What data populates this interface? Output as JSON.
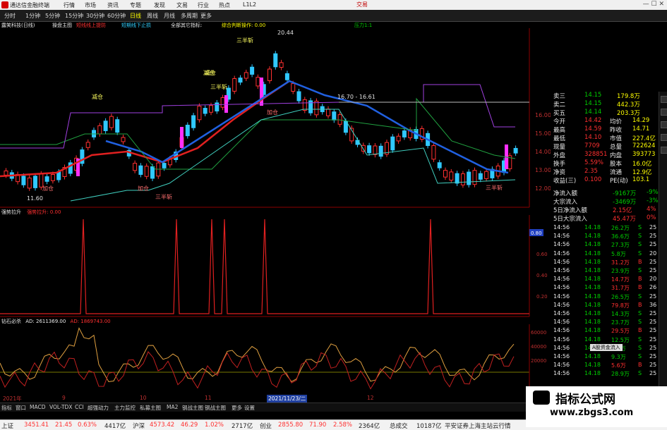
{
  "titlebar": {
    "title": "通达信金融终端",
    "right_text": "交易"
  },
  "menubar": {
    "items": [
      "行情",
      "市场",
      "资讯",
      "专题",
      "发现",
      "文易",
      "行业",
      "热点",
      "L1L2"
    ],
    "toolbar": [
      "分时",
      "1分钟",
      "5分钟",
      "15分钟",
      "30分钟",
      "60分钟",
      "日线",
      "周线",
      "月线",
      "多周期",
      "更多"
    ]
  },
  "main_chart": {
    "stock": "露笑科技(日线)",
    "label1": "操盘主图",
    "label2": "短线线上提防",
    "label3": "短期线下止损",
    "label4": "全部其它指标:",
    "label5": "综合判断操作: 0.00",
    "label6": "压力1:1",
    "price_high": "20.44",
    "price_low": "11.60",
    "range_label": "16.70 - 16.61",
    "annotations": [
      "减仓",
      "减仓",
      "三半斩",
      "三半斩",
      "加仓",
      "加仓",
      "三半斩",
      "减仓",
      "加仓",
      "三半斩"
    ],
    "yaxis": [
      "16.00",
      "15.00",
      "14.00",
      "13.00",
      "12.00"
    ]
  },
  "sub1": {
    "name": "强势拉升",
    "value": "强势拉升: 0.00",
    "yaxis": [
      "0.80",
      "0.60",
      "0.40",
      "0.20"
    ]
  },
  "sub2": {
    "name": "钻石必杀",
    "value": "AD: 2611369.00",
    "value2": "AD: 1869743.00",
    "yaxis": [
      "60000",
      "40000",
      "20000"
    ]
  },
  "xaxis": [
    "2021年",
    "9",
    "10",
    "11",
    "2021/11/23/二",
    "12"
  ],
  "quote": {
    "rows": [
      {
        "l": "卖三",
        "v": "14.15",
        "r": "179.8万"
      },
      {
        "l": "卖二",
        "v": "14.15",
        "r": "442.3万"
      },
      {
        "l": "买五",
        "v": "14.14",
        "r": "203.3万"
      },
      {
        "l": "今开",
        "v": "14.42",
        "r2l": "均价",
        "r": "14.29"
      },
      {
        "l": "最高",
        "v": "14.59",
        "r2l": "昨收",
        "r": "14.71"
      },
      {
        "l": "最低",
        "v": "14.10",
        "r2l": "市值",
        "r": "227.4亿"
      },
      {
        "l": "现量",
        "v": "7709",
        "r2l": "总量",
        "r": "722624"
      },
      {
        "l": "外盘",
        "v": "328851",
        "r2l": "内盘",
        "r": "393773"
      },
      {
        "l": "换手",
        "v": "5.59%",
        "r2l": "股本",
        "r": "16.0亿"
      },
      {
        "l": "净资",
        "v": "2.35",
        "r2l": "流通",
        "r": "12.9亿"
      },
      {
        "l": "收益(三)",
        "v": "0.100",
        "r2l": "PE(动)",
        "r": "103.1"
      }
    ],
    "flows": [
      {
        "l": "净流入额",
        "v": "-9167万",
        "p": "-9%"
      },
      {
        "l": "大宗流入",
        "v": "-3469万",
        "p": "-3%"
      },
      {
        "l": "5日净流入额",
        "v": "2.15亿",
        "p": "4%"
      },
      {
        "l": "5日大宗流入",
        "v": "45.47万",
        "p": "0%"
      }
    ],
    "ticks": [
      {
        "t": "14:56",
        "p": "14.18",
        "v": "26.2万",
        "s": "S",
        "n": "25"
      },
      {
        "t": "14:56",
        "p": "14.18",
        "v": "36.6万",
        "s": "S",
        "n": "25"
      },
      {
        "t": "14:56",
        "p": "14.18",
        "v": "27.3万",
        "s": "S",
        "n": "25"
      },
      {
        "t": "14:56",
        "p": "14.18",
        "v": "5.8万",
        "s": "S",
        "n": "20"
      },
      {
        "t": "14:56",
        "p": "14.18",
        "v": "31.2万",
        "s": "B",
        "n": "25"
      },
      {
        "t": "14:56",
        "p": "14.18",
        "v": "23.9万",
        "s": "S",
        "n": "25"
      },
      {
        "t": "14:56",
        "p": "14.18",
        "v": "14.7万",
        "s": "B",
        "n": "20"
      },
      {
        "t": "14:56",
        "p": "14.18",
        "v": "31.7万",
        "s": "B",
        "n": "26"
      },
      {
        "t": "14:56",
        "p": "14.18",
        "v": "26.5万",
        "s": "S",
        "n": "25"
      },
      {
        "t": "14:56",
        "p": "14.18",
        "v": "79.8万",
        "s": "B",
        "n": "36"
      },
      {
        "t": "14:56",
        "p": "14.18",
        "v": "14.3万",
        "s": "S",
        "n": "25"
      },
      {
        "t": "14:56",
        "p": "14.18",
        "v": "23.7万",
        "s": "S",
        "n": "25"
      },
      {
        "t": "14:56",
        "p": "14.18",
        "v": "29.5万",
        "s": "B",
        "n": "25"
      },
      {
        "t": "14:56",
        "p": "14.18",
        "v": "12.5万",
        "s": "S",
        "n": "25"
      },
      {
        "t": "14:56",
        "p": "14.18",
        "v": "9.5万",
        "s": "S",
        "n": "25"
      },
      {
        "t": "14:56",
        "p": "14.18",
        "v": "9.3万",
        "s": "S",
        "n": "25"
      },
      {
        "t": "14:56",
        "p": "14.18",
        "v": "5.6万",
        "s": "B",
        "n": "25"
      },
      {
        "t": "14:56",
        "p": "14.18",
        "v": "28.9万",
        "s": "S",
        "n": "25"
      }
    ],
    "popup": "A股资金流入"
  },
  "tabbar": [
    "指标",
    "窗口",
    "MACD",
    "VOL-TDX",
    "CCI",
    "超强动力",
    "主力监控",
    "私募主图",
    "MA2",
    "钢战主图",
    "钢战主图",
    "更多",
    "设置"
  ],
  "statusbar": {
    "sh_label": "上证",
    "sh_val": "3451.41",
    "sh_chg": "21.45",
    "sh_pct": "0.63%",
    "sh_amt": "4417亿",
    "sz_label": "沪深",
    "sz_val": "4573.42",
    "sz_chg": "46.29",
    "sz_pct": "1.02%",
    "sz_amt": "2717亿",
    "cy_label": "创业",
    "cy_val": "2855.80",
    "cy_chg": "71.90",
    "cy_pct": "2.58%",
    "cy_amt": "2364亿",
    "total_label": "总成交",
    "total_val": "10187亿",
    "note": "平安证券上海主站云行情"
  },
  "watermark": {
    "line1": "指标公式网",
    "line2": "www.zbgs3.com"
  },
  "colors": {
    "up": "#ff3030",
    "down": "#00c8ff",
    "magenta": "#ff30ff",
    "grid": "#8b0000",
    "ma_red": "#e02020",
    "ma_blue": "#2060e0"
  }
}
